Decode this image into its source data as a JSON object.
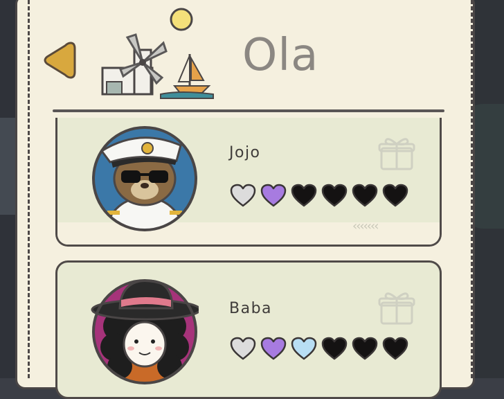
{
  "header": {
    "title": "Ola"
  },
  "friends": [
    {
      "name": "Jojo",
      "hearts": [
        "silver",
        "purple",
        "black",
        "black",
        "black",
        "black"
      ]
    },
    {
      "name": "Baba",
      "hearts": [
        "silver",
        "purple",
        "blue",
        "black",
        "black",
        "black"
      ]
    }
  ],
  "colors": {
    "paper": "#f5f0df",
    "card": "#e8ead3",
    "ink": "#4a4646",
    "heart_silver": "#dcdcdc",
    "heart_purple": "#a77be0",
    "heart_blue": "#b8def4",
    "heart_black": "#141212",
    "back_arrow": "#d8a83e"
  }
}
